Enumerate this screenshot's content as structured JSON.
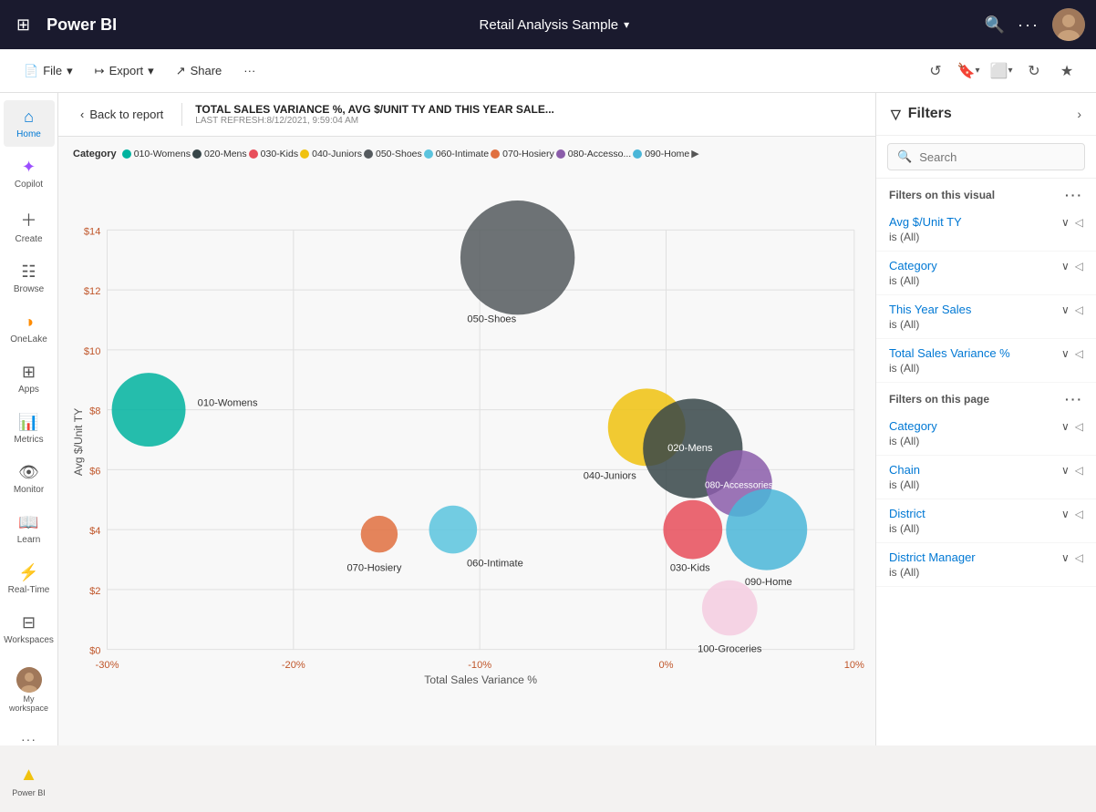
{
  "topbar": {
    "logo": "Power BI",
    "title": "Retail Analysis Sample",
    "chevron": "▾",
    "search_icon": "🔍",
    "more_icon": "···"
  },
  "toolbar": {
    "file_label": "File",
    "export_label": "Export",
    "share_label": "Share",
    "more_icon": "···",
    "undo_icon": "↺",
    "bookmark_icon": "🔖",
    "fit_icon": "⬜",
    "refresh_icon": "↻",
    "favorite_icon": "★"
  },
  "sidebar": {
    "items": [
      {
        "label": "Home",
        "icon": "⌂",
        "id": "home",
        "active": true
      },
      {
        "label": "Copilot",
        "icon": "✦",
        "id": "copilot"
      },
      {
        "label": "Create",
        "icon": "+",
        "id": "create"
      },
      {
        "label": "Browse",
        "icon": "☷",
        "id": "browse"
      },
      {
        "label": "OneLake",
        "icon": "◑",
        "id": "onelake"
      },
      {
        "label": "Apps",
        "icon": "⊞",
        "id": "apps"
      },
      {
        "label": "Metrics",
        "icon": "📊",
        "id": "metrics"
      },
      {
        "label": "Monitor",
        "icon": "👁",
        "id": "monitor"
      },
      {
        "label": "Learn",
        "icon": "📖",
        "id": "learn"
      },
      {
        "label": "Real-Time",
        "icon": "⚡",
        "id": "realtime"
      },
      {
        "label": "Workspaces",
        "icon": "⊟",
        "id": "workspaces"
      }
    ],
    "bottom": [
      {
        "label": "My workspace",
        "icon": "👤",
        "id": "myworkspace"
      },
      {
        "label": "",
        "icon": "···",
        "id": "more"
      },
      {
        "label": "Power BI",
        "icon": "📊",
        "id": "powerbi"
      }
    ]
  },
  "report_header": {
    "back_label": "Back to report",
    "title": "TOTAL SALES VARIANCE %, AVG $/UNIT TY AND THIS YEAR SALE...",
    "refresh_line1": "LAST REFRESH:8/12/2021,",
    "refresh_line2": "9:59:04 AM"
  },
  "legend": {
    "category_label": "Category",
    "items": [
      {
        "label": "010-Womens",
        "color": "#00b39f"
      },
      {
        "label": "020-Mens",
        "color": "#374649"
      },
      {
        "label": "030-Kids",
        "color": "#e84e5a"
      },
      {
        "label": "040-Juniors",
        "color": "#f0c20f"
      },
      {
        "label": "050-Shoes",
        "color": "#555a5e"
      },
      {
        "label": "060-Intimate",
        "color": "#5bc4de"
      },
      {
        "label": "070-Hosiery",
        "color": "#e07040"
      },
      {
        "label": "080-Accesso...",
        "color": "#8b5daa"
      },
      {
        "label": "090-Home",
        "color": "#00b0f0"
      }
    ],
    "more": "▶"
  },
  "chart": {
    "x_axis_label": "Total Sales Variance %",
    "y_axis_label": "Avg $/Unit TY",
    "x_ticks": [
      "-30%",
      "-20%",
      "-10%",
      "0%",
      "10%"
    ],
    "y_ticks": [
      "$0",
      "$2",
      "$4",
      "$6",
      "$8",
      "$10",
      "$12",
      "$14"
    ],
    "bubbles": [
      {
        "id": "womens",
        "label": "010-Womens",
        "x": 0.08,
        "y": 0.54,
        "r": 38,
        "color": "#00b39f"
      },
      {
        "id": "mens",
        "label": "020-Mens",
        "x": 0.68,
        "y": 0.47,
        "r": 52,
        "color": "#374649"
      },
      {
        "id": "kids",
        "label": "030-Kids",
        "x": 0.67,
        "y": 0.39,
        "r": 32,
        "color": "#e84e5a"
      },
      {
        "id": "juniors",
        "label": "040-Juniors",
        "x": 0.53,
        "y": 0.49,
        "r": 40,
        "color": "#f0c20f"
      },
      {
        "id": "shoes",
        "label": "050-Shoes",
        "x": 0.55,
        "y": 0.84,
        "r": 60,
        "color": "#555a5e"
      },
      {
        "id": "intimate",
        "label": "060-Intimate",
        "x": 0.36,
        "y": 0.36,
        "r": 26,
        "color": "#5bc4de"
      },
      {
        "id": "hosiery",
        "label": "070-Hosiery",
        "x": 0.29,
        "y": 0.36,
        "r": 20,
        "color": "#e07040"
      },
      {
        "id": "accessories",
        "label": "080-Accessories",
        "x": 0.72,
        "y": 0.43,
        "r": 35,
        "color": "#8b5daa"
      },
      {
        "id": "home",
        "label": "090-Home",
        "x": 0.76,
        "y": 0.38,
        "r": 42,
        "color": "#4ab6d8"
      },
      {
        "id": "groceries",
        "label": "100-Groceries",
        "x": 0.74,
        "y": 0.14,
        "r": 28,
        "color": "#f4cce0"
      }
    ]
  },
  "filters": {
    "title": "Filters",
    "search_placeholder": "Search",
    "on_visual_label": "Filters on this visual",
    "on_page_label": "Filters on this page",
    "visual_filters": [
      {
        "name": "Avg $/Unit TY",
        "value": "is (All)"
      },
      {
        "name": "Category",
        "value": "is (All)"
      },
      {
        "name": "This Year Sales",
        "value": "is (All)"
      },
      {
        "name": "Total Sales Variance %",
        "value": "is (All)"
      }
    ],
    "page_filters": [
      {
        "name": "Category",
        "value": "is (All)"
      },
      {
        "name": "Chain",
        "value": "is (All)"
      },
      {
        "name": "District",
        "value": "is (All)"
      },
      {
        "name": "District Manager",
        "value": "is (All)"
      }
    ]
  }
}
